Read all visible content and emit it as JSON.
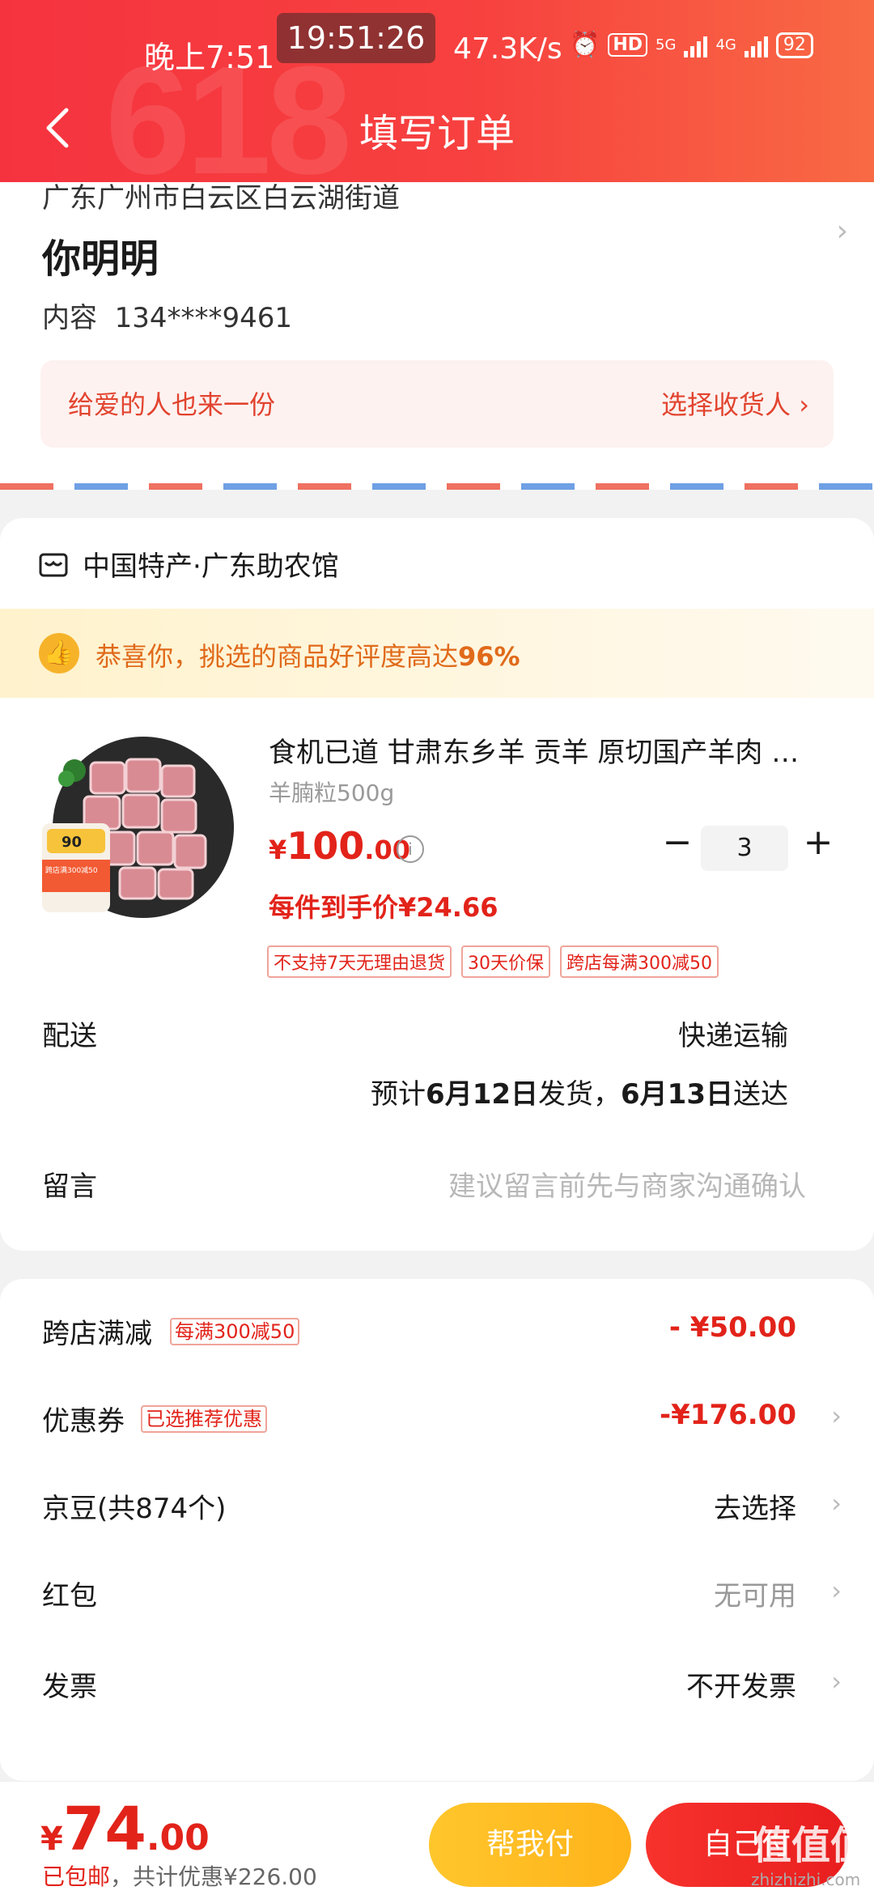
{
  "status_bar": {
    "time": "晚上7:51",
    "clock": "19:51:26",
    "network_speed": "47.3K/s",
    "hd_badge": "HD",
    "net1": "5G",
    "net2": "4G",
    "battery": "92"
  },
  "header": {
    "title": "填写订单",
    "background_watermark": "618"
  },
  "address": {
    "line": "广东广州市白云区白云湖街道",
    "name": "你明明",
    "contact_label": "内容",
    "phone": "134****9461",
    "gift_text": "给爱的人也来一份",
    "choose_receiver": "选择收货人 ›"
  },
  "shop": {
    "name": "中国特产·广东助农馆",
    "praise_prefix": "恭喜你，挑选的商品好评度高达",
    "praise_value": "96%",
    "product": {
      "title": "食机已道 甘肃东乡羊 贡羊  原切国产羊肉 …",
      "spec": "羊腩粒500g",
      "price_symbol": "¥",
      "price_int": "100",
      "price_dec": ".00",
      "quantity": "3",
      "unit_price": "每件到手价¥24.66",
      "img_badge": "90",
      "img_promo": "跨店满300减50",
      "tags": [
        "不支持7天无理由退货",
        "30天价保",
        "跨店每满300减50"
      ]
    },
    "delivery": {
      "label": "配送",
      "method": "快递运输",
      "eta_prefix": "预计",
      "ship_date": "6月12日",
      "ship_text": "发货，",
      "arrive_date": "6月13日",
      "arrive_text": "送达"
    },
    "memo": {
      "label": "留言",
      "placeholder": "建议留言前先与商家沟通确认"
    }
  },
  "discounts": {
    "cross_store": {
      "label": "跨店满减",
      "pill": "每满300减50",
      "value": "- ¥50.00"
    },
    "coupon": {
      "label": "优惠券",
      "pill": "已选推荐优惠",
      "value": "-¥176.00"
    },
    "beans": {
      "label": "京豆(共874个)",
      "value": "去选择"
    },
    "red_packet": {
      "label": "红包",
      "value": "无可用"
    },
    "invoice": {
      "label": "发票",
      "value": "不开发票"
    }
  },
  "bottom": {
    "currency": "¥",
    "total_int": "74",
    "total_dec": ".00",
    "shipping": "已包邮",
    "saved": "，共计优惠¥226.00",
    "help_pay": "帮我付",
    "self_pay": "自己付",
    "watermark": "值值值",
    "watermark_url": "zhizhizhi.com"
  },
  "colors": {
    "accent_red": "#e2231a",
    "header_red": "#f5333f",
    "help_yellow": "#ffc62c"
  }
}
